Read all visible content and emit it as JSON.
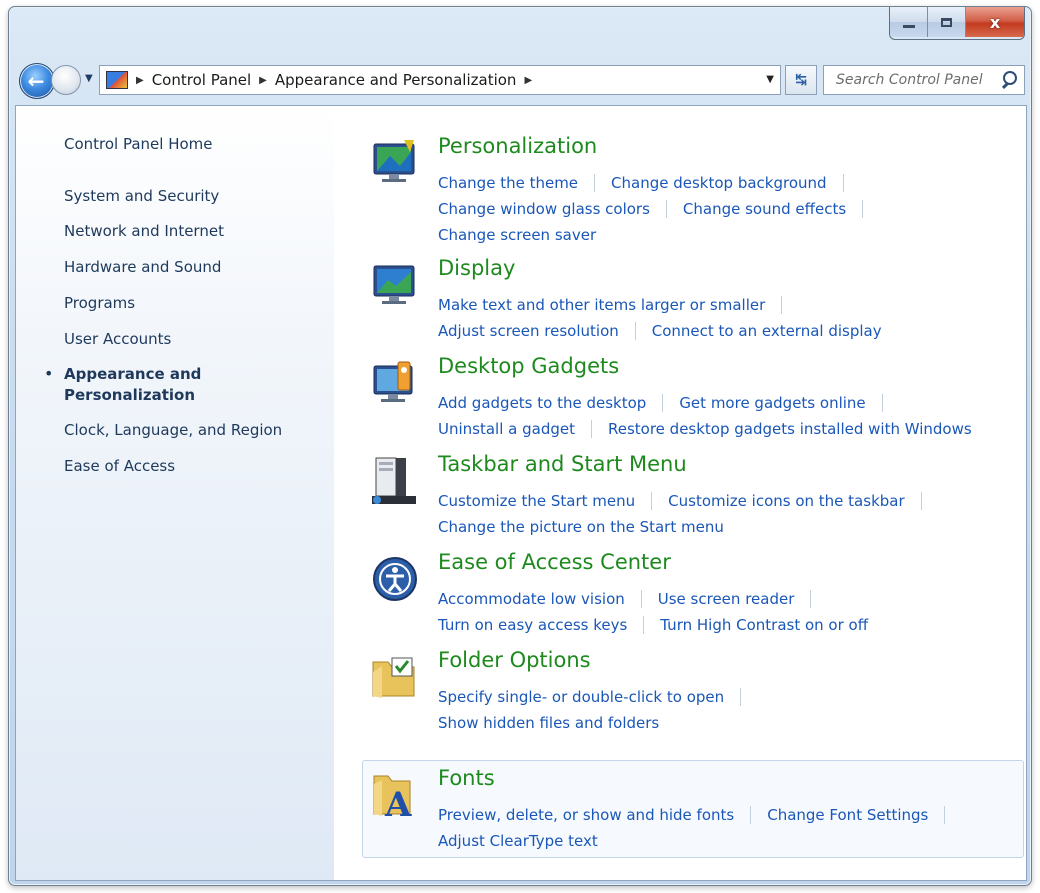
{
  "window": {
    "caption": {
      "minimize_icon": "minimize-icon",
      "maximize_icon": "maximize-icon",
      "close_glyph": "x"
    }
  },
  "navbar": {
    "breadcrumb": [
      "Control Panel",
      "Appearance and Personalization"
    ],
    "search_placeholder": "Search Control Panel",
    "refresh_glyph": "↹"
  },
  "sidebar": {
    "home": "Control Panel Home",
    "items": [
      "System and Security",
      "Network and Internet",
      "Hardware and Sound",
      "Programs",
      "User Accounts",
      "Appearance and Personalization",
      "Clock, Language, and Region",
      "Ease of Access"
    ],
    "active_bullet": "•"
  },
  "categories": [
    {
      "title": "Personalization",
      "rows": [
        [
          "Change the theme",
          "Change desktop background"
        ],
        [
          "Change window glass colors",
          "Change sound effects"
        ],
        [
          "Change screen saver"
        ]
      ]
    },
    {
      "title": "Display",
      "rows": [
        [
          "Make text and other items larger or smaller"
        ],
        [
          "Adjust screen resolution",
          "Connect to an external display"
        ]
      ]
    },
    {
      "title": "Desktop Gadgets",
      "rows": [
        [
          "Add gadgets to the desktop",
          "Get more gadgets online"
        ],
        [
          "Uninstall a gadget",
          "Restore desktop gadgets installed with Windows"
        ]
      ]
    },
    {
      "title": "Taskbar and Start Menu",
      "rows": [
        [
          "Customize the Start menu",
          "Customize icons on the taskbar"
        ],
        [
          "Change the picture on the Start menu"
        ]
      ]
    },
    {
      "title": "Ease of Access Center",
      "rows": [
        [
          "Accommodate low vision",
          "Use screen reader"
        ],
        [
          "Turn on easy access keys",
          "Turn High Contrast on or off"
        ]
      ]
    },
    {
      "title": "Folder Options",
      "rows": [
        [
          "Specify single- or double-click to open"
        ],
        [
          "Show hidden files and folders"
        ]
      ]
    },
    {
      "title": "Fonts",
      "rows": [
        [
          "Preview, delete, or show and hide fonts",
          "Change Font Settings"
        ],
        [
          "Adjust ClearType text"
        ]
      ]
    }
  ],
  "colors": {
    "category_title": "#1e8a1e",
    "link": "#1a57b8",
    "sidebar_text": "#1e395b"
  }
}
